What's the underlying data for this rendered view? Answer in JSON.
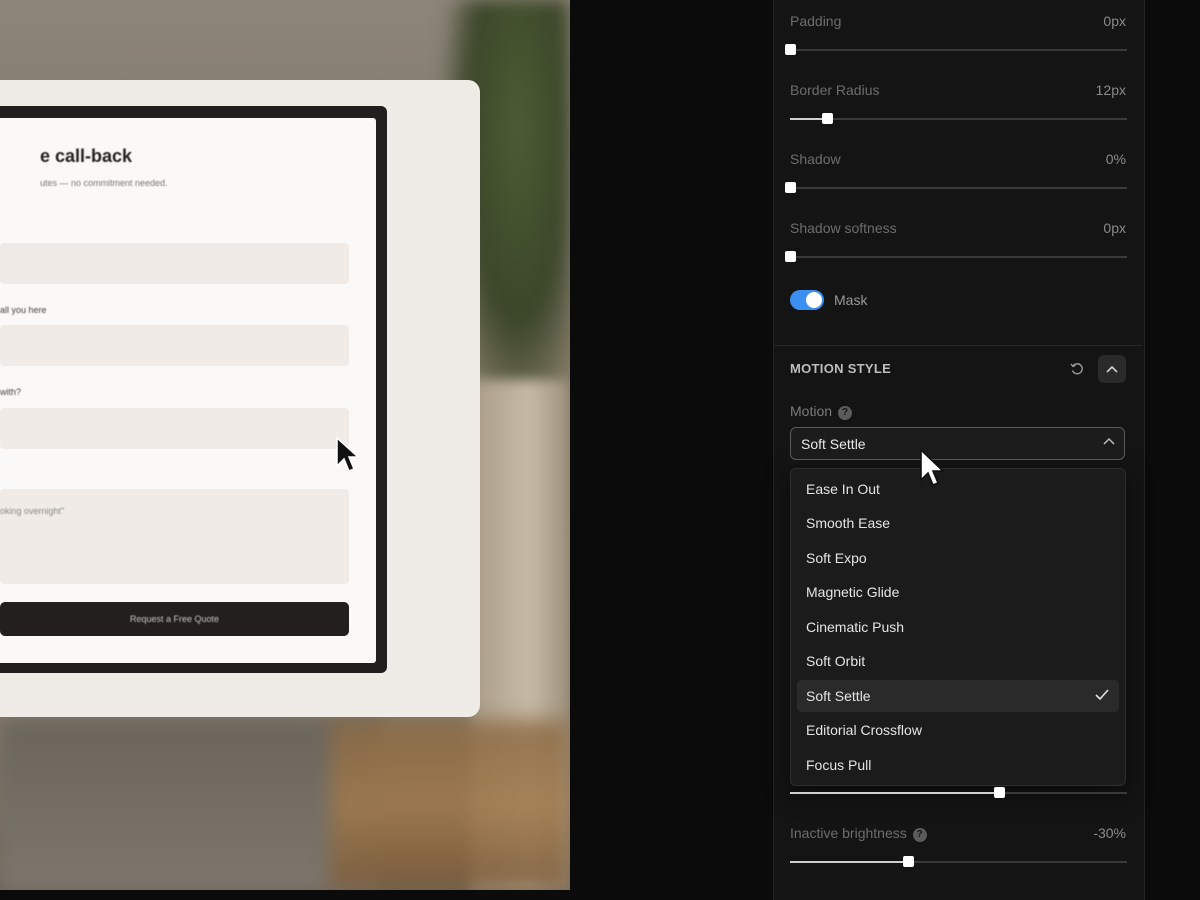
{
  "canvas": {
    "form": {
      "title": "e call-back",
      "subtitle": "utes — no commitment needed.",
      "field_labels": [
        "all you here",
        "with?"
      ],
      "textarea_placeholder": "oking overnight\"",
      "submit_label": "Request a Free Quote"
    }
  },
  "inspector": {
    "sliders_top": [
      {
        "label": "Padding",
        "value": "0px",
        "fraction": 0.0
      },
      {
        "label": "Border Radius",
        "value": "12px",
        "fraction": 0.11
      },
      {
        "label": "Shadow",
        "value": "0%",
        "fraction": 0.0
      },
      {
        "label": "Shadow softness",
        "value": "0px",
        "fraction": 0.0
      }
    ],
    "mask": {
      "label": "Mask",
      "on": true
    },
    "motion_section": {
      "title": "MOTION STYLE",
      "motion_label": "Motion",
      "selected": "Soft Settle",
      "options": [
        "Ease In Out",
        "Smooth Ease",
        "Soft Expo",
        "Magnetic Glide",
        "Cinematic Push",
        "Soft Orbit",
        "Soft Settle",
        "Editorial Crossflow",
        "Focus Pull"
      ]
    },
    "hidden_slider_fraction": 0.62,
    "inactive_brightness": {
      "label": "Inactive brightness",
      "value": "-30%",
      "fraction": 0.35
    }
  },
  "colors": {
    "accent": "#3b8ff0",
    "panel_bg": "#141414"
  },
  "icons": [
    "reset-icon",
    "chevron-up-icon",
    "help-icon",
    "check-icon",
    "cursor-icon"
  ]
}
